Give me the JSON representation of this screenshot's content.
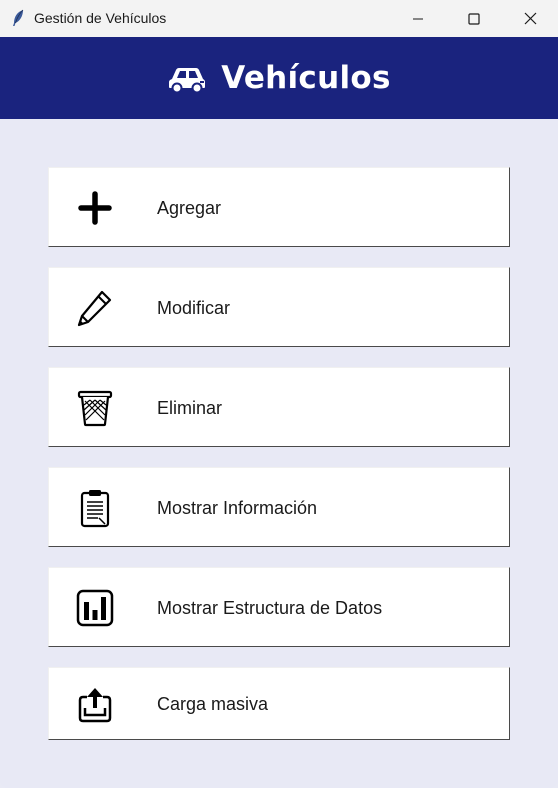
{
  "window": {
    "title": "Gestión de Vehículos",
    "app_icon": "feather-icon",
    "controls": [
      "minimize-icon",
      "maximize-icon",
      "close-icon"
    ]
  },
  "header": {
    "title": "Vehículos",
    "icon": "car-icon",
    "background": "#1a237e",
    "text_color": "#ffffff"
  },
  "menu": {
    "items": [
      {
        "label": "Agregar",
        "icon": "plus-icon"
      },
      {
        "label": "Modificar",
        "icon": "pencil-icon"
      },
      {
        "label": "Eliminar",
        "icon": "trash-icon"
      },
      {
        "label": "Mostrar Información",
        "icon": "clipboard-icon"
      },
      {
        "label": "Mostrar Estructura de Datos",
        "icon": "bar-chart-icon"
      },
      {
        "label": "Carga masiva",
        "icon": "upload-icon"
      }
    ]
  },
  "colors": {
    "window_background": "#e8e9f5",
    "button_background": "#ffffff"
  }
}
